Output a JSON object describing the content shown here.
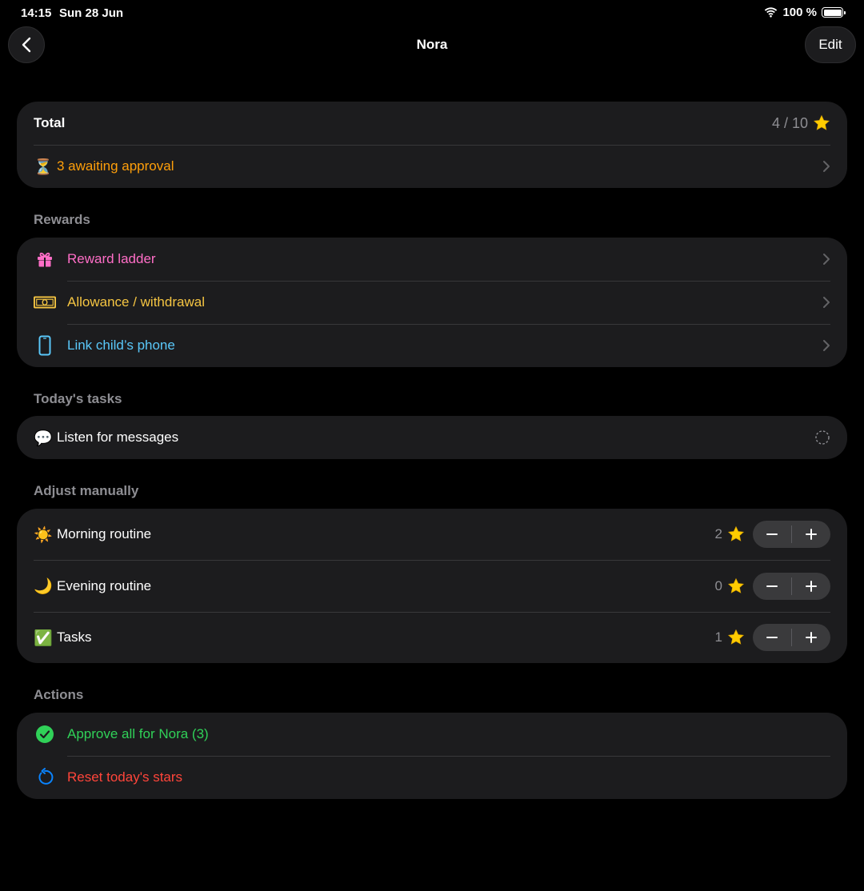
{
  "status_bar": {
    "time": "14:15",
    "date": "Sun 28 Jun",
    "battery": "100 %"
  },
  "nav": {
    "title": "Nora",
    "edit_label": "Edit"
  },
  "total": {
    "label": "Total",
    "value": "4 / 10",
    "pending_text": "3 awaiting approval"
  },
  "sections": {
    "rewards": "Rewards",
    "todays_tasks": "Today's tasks",
    "adjust": "Adjust manually",
    "actions": "Actions"
  },
  "rewards": {
    "items": [
      {
        "label": "Reward ladder",
        "icon": "gift-icon",
        "color": "#ff6ec7"
      },
      {
        "label": "Allowance / withdrawal",
        "icon": "banknote-icon",
        "color": "#f5c542"
      },
      {
        "label": "Link child’s phone",
        "icon": "phone-icon",
        "color": "#5ac8fa"
      }
    ]
  },
  "tasks": {
    "items": [
      {
        "label": "Listen for messages",
        "icon": "speech-bubble-icon"
      }
    ]
  },
  "adjust": {
    "items": [
      {
        "label": "Morning routine",
        "icon": "sun-icon",
        "count": "2"
      },
      {
        "label": "Evening routine",
        "icon": "moon-icon",
        "count": "0"
      },
      {
        "label": "Tasks",
        "icon": "checkmark-icon",
        "count": "1"
      }
    ]
  },
  "actions": {
    "approve_label": "Approve all for Nora (3)",
    "reset_label": "Reset today's stars"
  },
  "colors": {
    "orange": "#ff9f0a",
    "green": "#30d158",
    "red": "#ff453a",
    "card": "#1c1c1e"
  }
}
